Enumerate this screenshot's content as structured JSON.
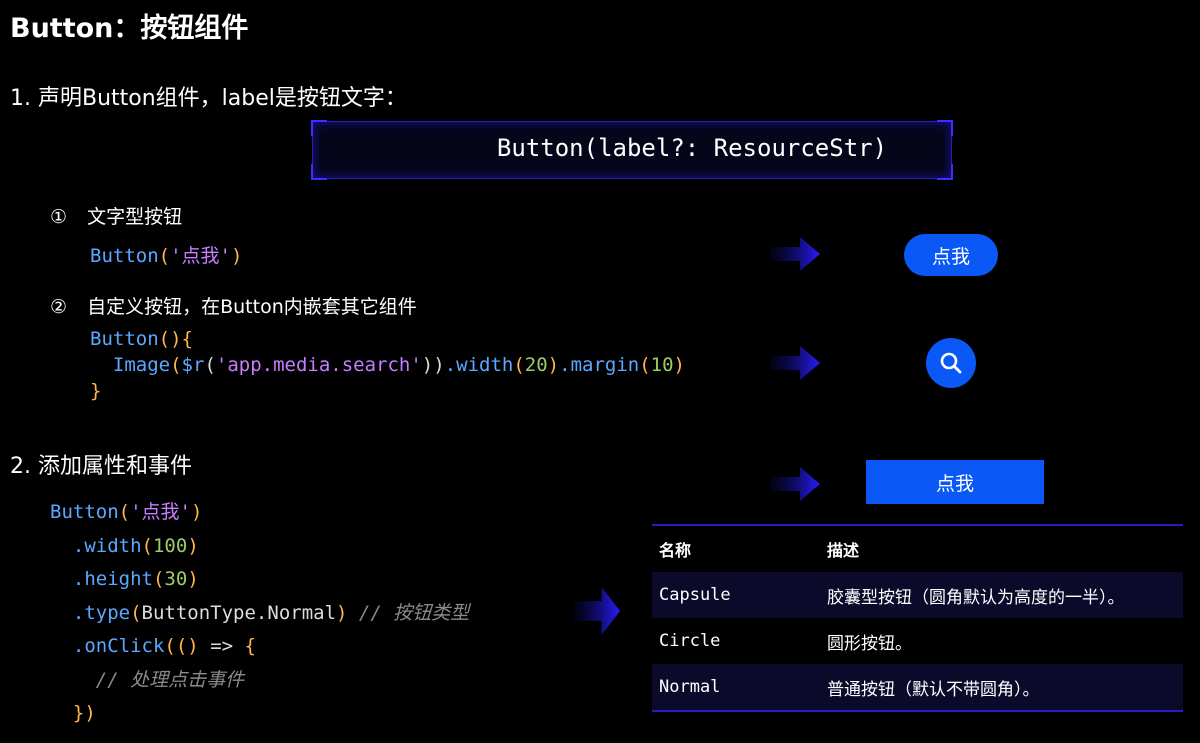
{
  "title": "Button：按钮组件",
  "section1": {
    "heading": "1. 声明Button组件，label是按钮文字：",
    "signature": "Button(label?: ResourceStr)",
    "item1": {
      "marker": "①",
      "label": "文字型按钮",
      "code": {
        "fn": "Button",
        "open": "(",
        "str": "'点我'",
        "close": ")"
      },
      "preview_label": "点我"
    },
    "item2": {
      "marker": "②",
      "label": "自定义按钮，在Button内嵌套其它组件",
      "code": {
        "line1_fn": "Button",
        "line1_rest": "(){",
        "line2_fn": "Image",
        "line2_p1": "(",
        "line2_fn2": "$r",
        "line2_p2": "(",
        "line2_str": "'app.media.search'",
        "line2_p3": "))",
        "line2_m1": ".width",
        "line2_p4": "(",
        "line2_n1": "20",
        "line2_p5": ")",
        "line2_m2": ".margin",
        "line2_p6": "(",
        "line2_n2": "10",
        "line2_p7": ")",
        "line3": "}"
      },
      "preview_icon": "search-icon"
    }
  },
  "section2": {
    "heading": "2. 添加属性和事件",
    "code": {
      "l1_fn": "Button",
      "l1_p1": "(",
      "l1_str": "'点我'",
      "l1_p2": ")",
      "l2_m": ".width",
      "l2_p1": "(",
      "l2_n": "100",
      "l2_p2": ")",
      "l3_m": ".height",
      "l3_p1": "(",
      "l3_n": "30",
      "l3_p2": ")",
      "l4_m": ".type",
      "l4_p1": "(",
      "l4_arg": "ButtonType.Normal",
      "l4_p2": ")",
      "l4_cmt": "// 按钮类型",
      "l5_m": ".onClick",
      "l5_p1": "((",
      "l5_p2": ")",
      "l5_arrow": " => ",
      "l5_b": "{",
      "l6_cmt": "// 处理点击事件",
      "l7_b": "}",
      "l7_p": ")"
    },
    "preview_label": "点我"
  },
  "table": {
    "headers": [
      "名称",
      "描述"
    ],
    "rows": [
      {
        "name": "Capsule",
        "desc": "胶囊型按钮（圆角默认为高度的一半）。"
      },
      {
        "name": "Circle",
        "desc": "圆形按钮。"
      },
      {
        "name": "Normal",
        "desc": "普通按钮（默认不带圆角）。"
      }
    ]
  },
  "colors": {
    "accent": "#0a59f7",
    "frame": "#2a1cc0",
    "background": "#000000"
  },
  "icons": [
    "arrow-right-icon",
    "search-icon"
  ]
}
